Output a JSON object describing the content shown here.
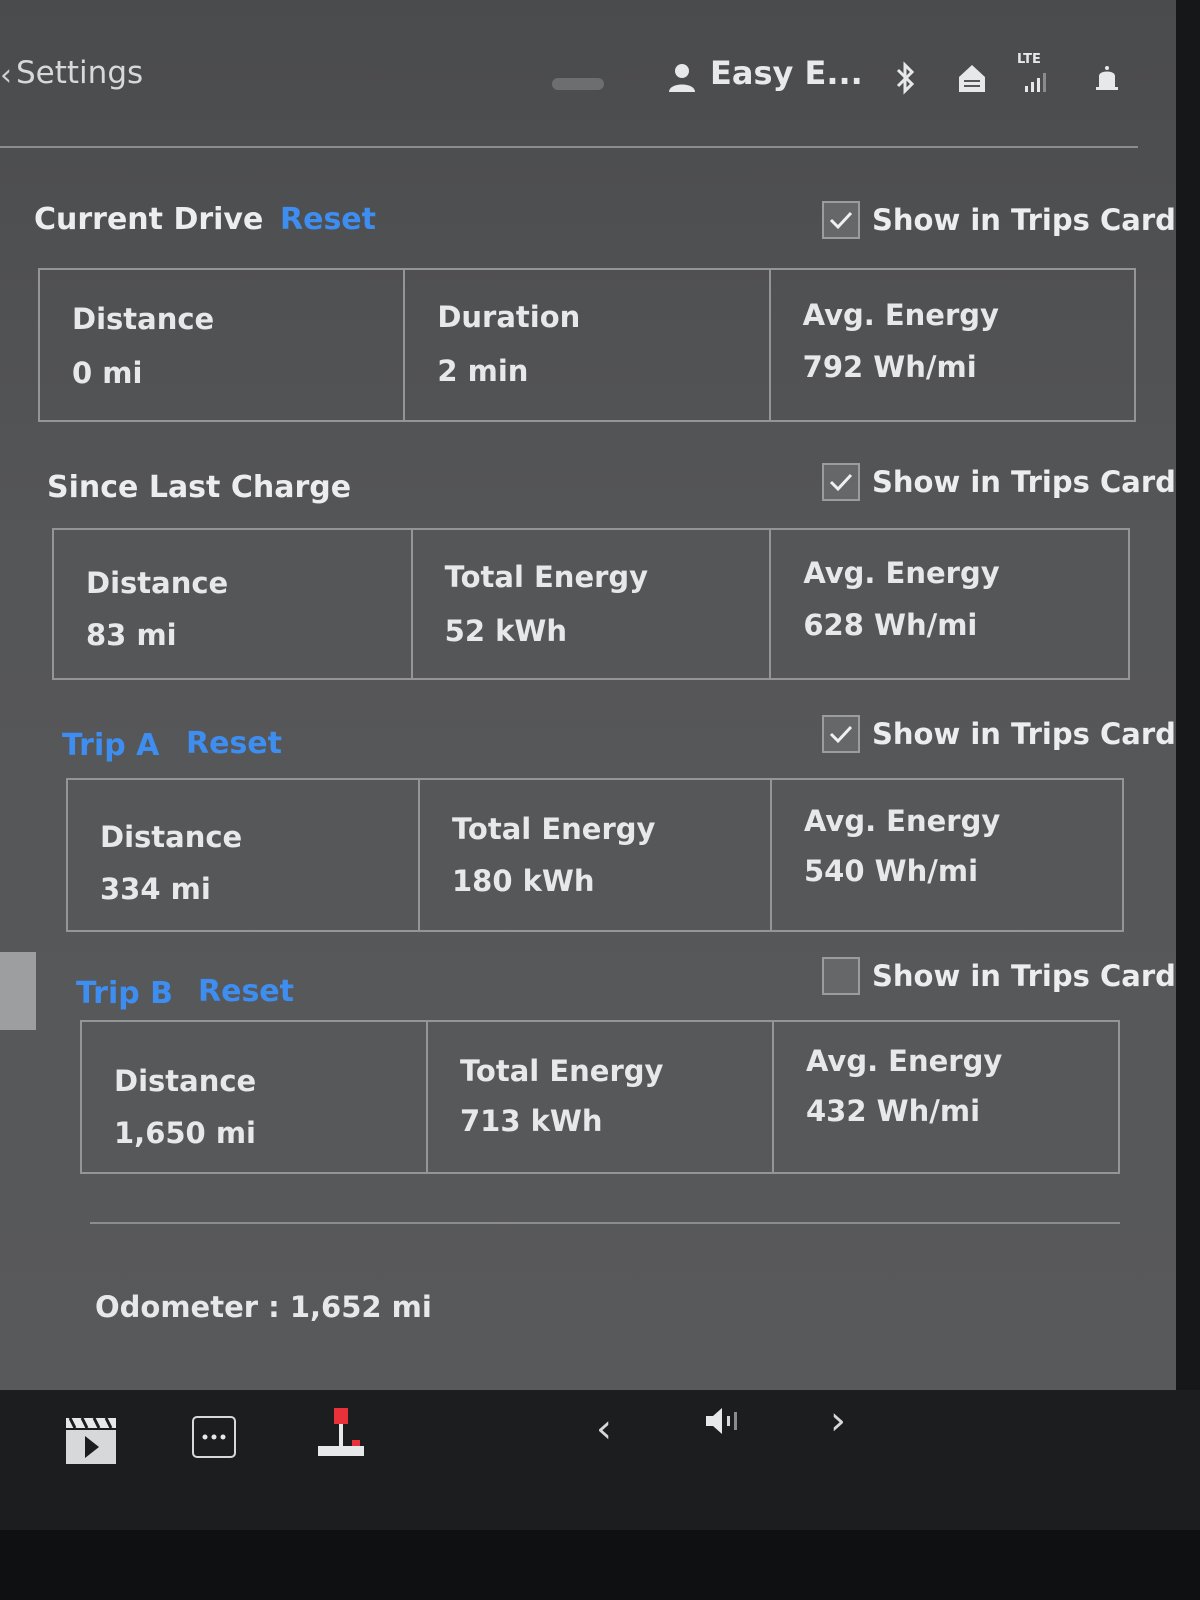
{
  "header": {
    "back_chevron": "‹",
    "back_label": "Settings",
    "profile_name": "Easy E...",
    "icons": [
      "user-icon",
      "bluetooth-icon",
      "home-icon",
      "lte-signal-icon",
      "bell-icon"
    ],
    "lte_label": "LTE"
  },
  "colors": {
    "accent": "#3e8ef2",
    "background": "#555658",
    "text": "#e6e8ea"
  },
  "sections": {
    "current_drive": {
      "title": "Current Drive",
      "reset": "Reset",
      "show_label": "Show in Trips Card",
      "show_checked": true,
      "stats": [
        {
          "label": "Distance",
          "value": "0 mi"
        },
        {
          "label": "Duration",
          "value": "2 min"
        },
        {
          "label": "Avg. Energy",
          "value": "792 Wh/mi"
        }
      ]
    },
    "since_last_charge": {
      "title": "Since Last Charge",
      "show_label": "Show in Trips Card",
      "show_checked": true,
      "stats": [
        {
          "label": "Distance",
          "value": "83 mi"
        },
        {
          "label": "Total Energy",
          "value": "52 kWh"
        },
        {
          "label": "Avg. Energy",
          "value": "628 Wh/mi"
        }
      ]
    },
    "trip_a": {
      "title": "Trip A",
      "reset": "Reset",
      "show_label": "Show in Trips Card",
      "show_checked": true,
      "stats": [
        {
          "label": "Distance",
          "value": "334 mi"
        },
        {
          "label": "Total Energy",
          "value": "180 kWh"
        },
        {
          "label": "Avg. Energy",
          "value": "540 Wh/mi"
        }
      ]
    },
    "trip_b": {
      "title": "Trip B",
      "reset": "Reset",
      "show_label": "Show in Trips Card",
      "show_checked": false,
      "stats": [
        {
          "label": "Distance",
          "value": "1,650 mi"
        },
        {
          "label": "Total Energy",
          "value": "713 kWh"
        },
        {
          "label": "Avg. Energy",
          "value": "432 Wh/mi"
        }
      ]
    }
  },
  "odometer": "Odometer : 1,652 mi",
  "dock": {
    "items": [
      "video-player-icon",
      "more-apps-icon",
      "joystick-icon",
      "prev-chevron-icon",
      "volume-icon",
      "next-chevron-icon"
    ],
    "prev": "‹",
    "next": "›"
  }
}
